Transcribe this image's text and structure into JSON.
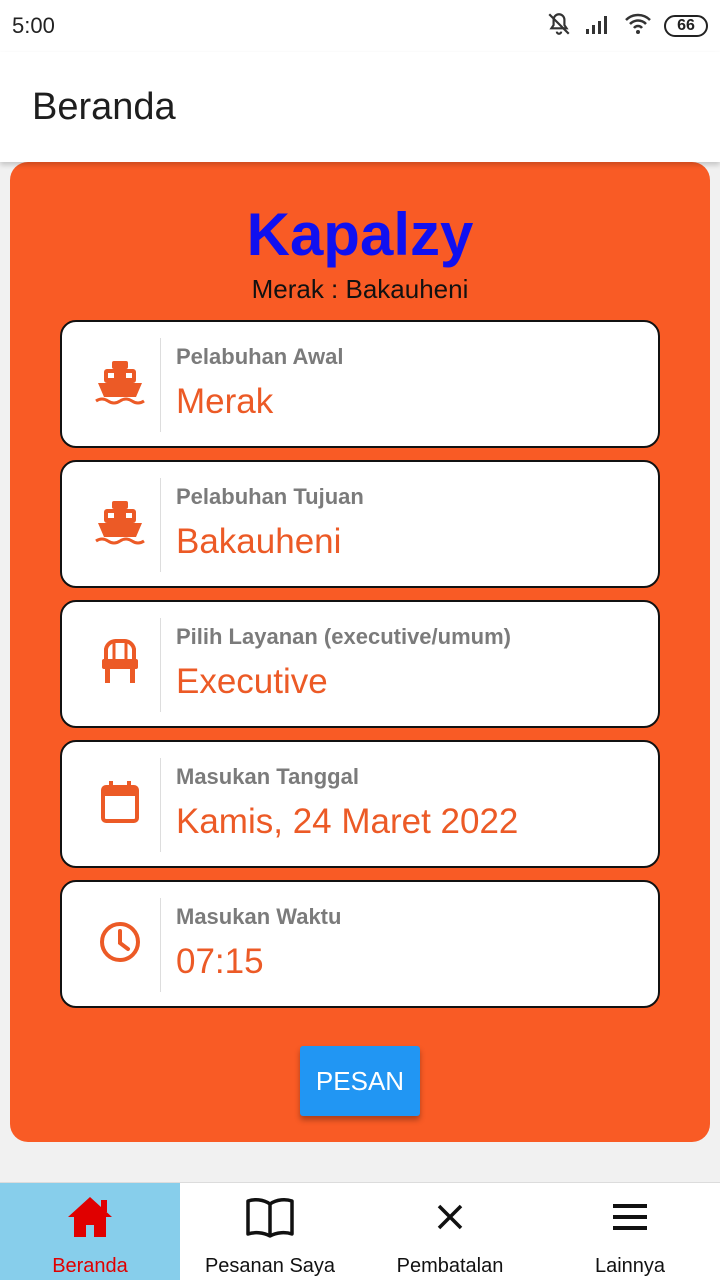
{
  "status_bar": {
    "time": "5:00",
    "battery": "66"
  },
  "app_bar": {
    "title": "Beranda"
  },
  "card": {
    "brand": "Kapalzy",
    "route": "Merak : Bakauheni",
    "fields": [
      {
        "icon": "ship-icon",
        "label": "Pelabuhan Awal",
        "value": "Merak"
      },
      {
        "icon": "ship-icon",
        "label": "Pelabuhan Tujuan",
        "value": "Bakauheni"
      },
      {
        "icon": "chair-icon",
        "label": "Pilih Layanan (executive/umum)",
        "value": "Executive"
      },
      {
        "icon": "calendar-icon",
        "label": "Masukan Tanggal",
        "value": "Kamis, 24 Maret 2022"
      },
      {
        "icon": "clock-icon",
        "label": "Masukan Waktu",
        "value": "07:15"
      }
    ],
    "order_button": "PESAN"
  },
  "bottom_nav": {
    "items": [
      {
        "label": "Beranda",
        "icon": "home-icon",
        "active": true
      },
      {
        "label": "Pesanan Saya",
        "icon": "book-icon",
        "active": false
      },
      {
        "label": "Pembatalan",
        "icon": "close-icon",
        "active": false
      },
      {
        "label": "Lainnya",
        "icon": "menu-icon",
        "active": false
      }
    ]
  },
  "colors": {
    "card_bg": "#f95b25",
    "brand": "#1010f0",
    "field_value": "#ec5a26",
    "button": "#2196f3",
    "nav_active_bg": "#87ceeb",
    "nav_active_text": "#e00000"
  }
}
